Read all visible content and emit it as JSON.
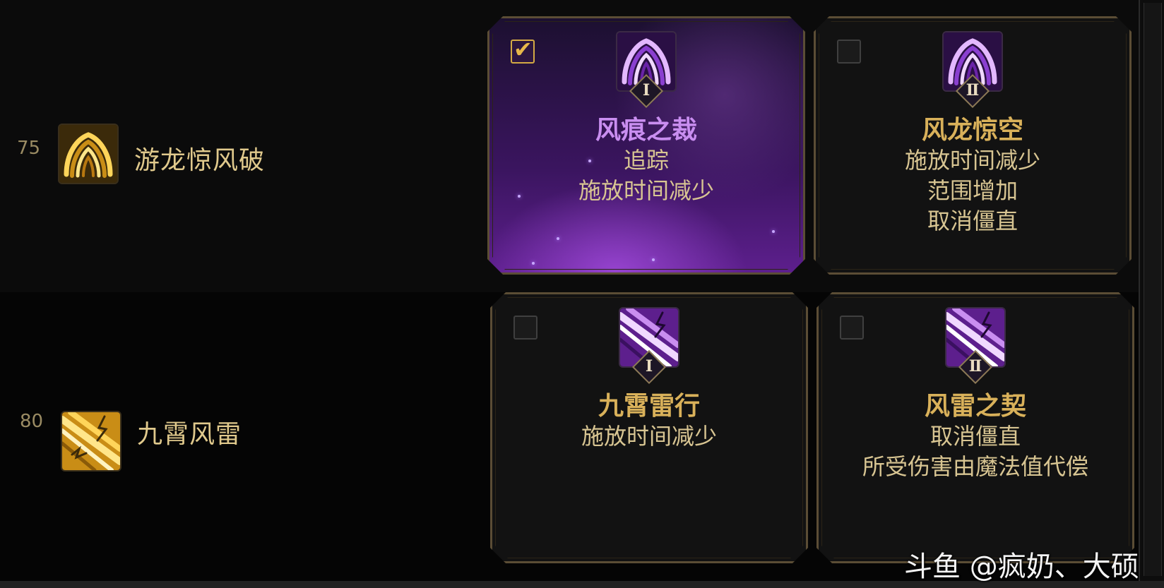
{
  "skills": [
    {
      "level": "75",
      "name": "游龙惊风破",
      "icon": "golden-swirl-icon",
      "options": [
        {
          "selected": true,
          "roman": "Ⅰ",
          "icon": "purple-swirl-icon",
          "title": "风痕之裁",
          "lines": [
            "追踪",
            "施放时间减少"
          ]
        },
        {
          "selected": false,
          "roman": "Ⅱ",
          "icon": "purple-swirl-icon",
          "title": "风龙惊空",
          "lines": [
            "施放时间减少",
            "范围增加",
            "取消僵直"
          ]
        }
      ]
    },
    {
      "level": "80",
      "name": "九霄风雷",
      "icon": "golden-lightning-icon",
      "options": [
        {
          "selected": false,
          "roman": "Ⅰ",
          "icon": "purple-lightning-icon",
          "title": "九霄雷行",
          "lines": [
            "施放时间减少"
          ]
        },
        {
          "selected": false,
          "roman": "Ⅱ",
          "icon": "purple-lightning-icon",
          "title": "风雷之契",
          "lines": [
            "取消僵直",
            "所受伤害由魔法值代偿"
          ]
        }
      ]
    }
  ],
  "watermark": "斗鱼 @疯奶、大硕",
  "colors": {
    "selected_title": "#c98ef0",
    "title": "#d9b15a",
    "body_text": "#d8c592",
    "card_border": "#5b4d35",
    "checkbox_tick": "#e8b84a"
  }
}
